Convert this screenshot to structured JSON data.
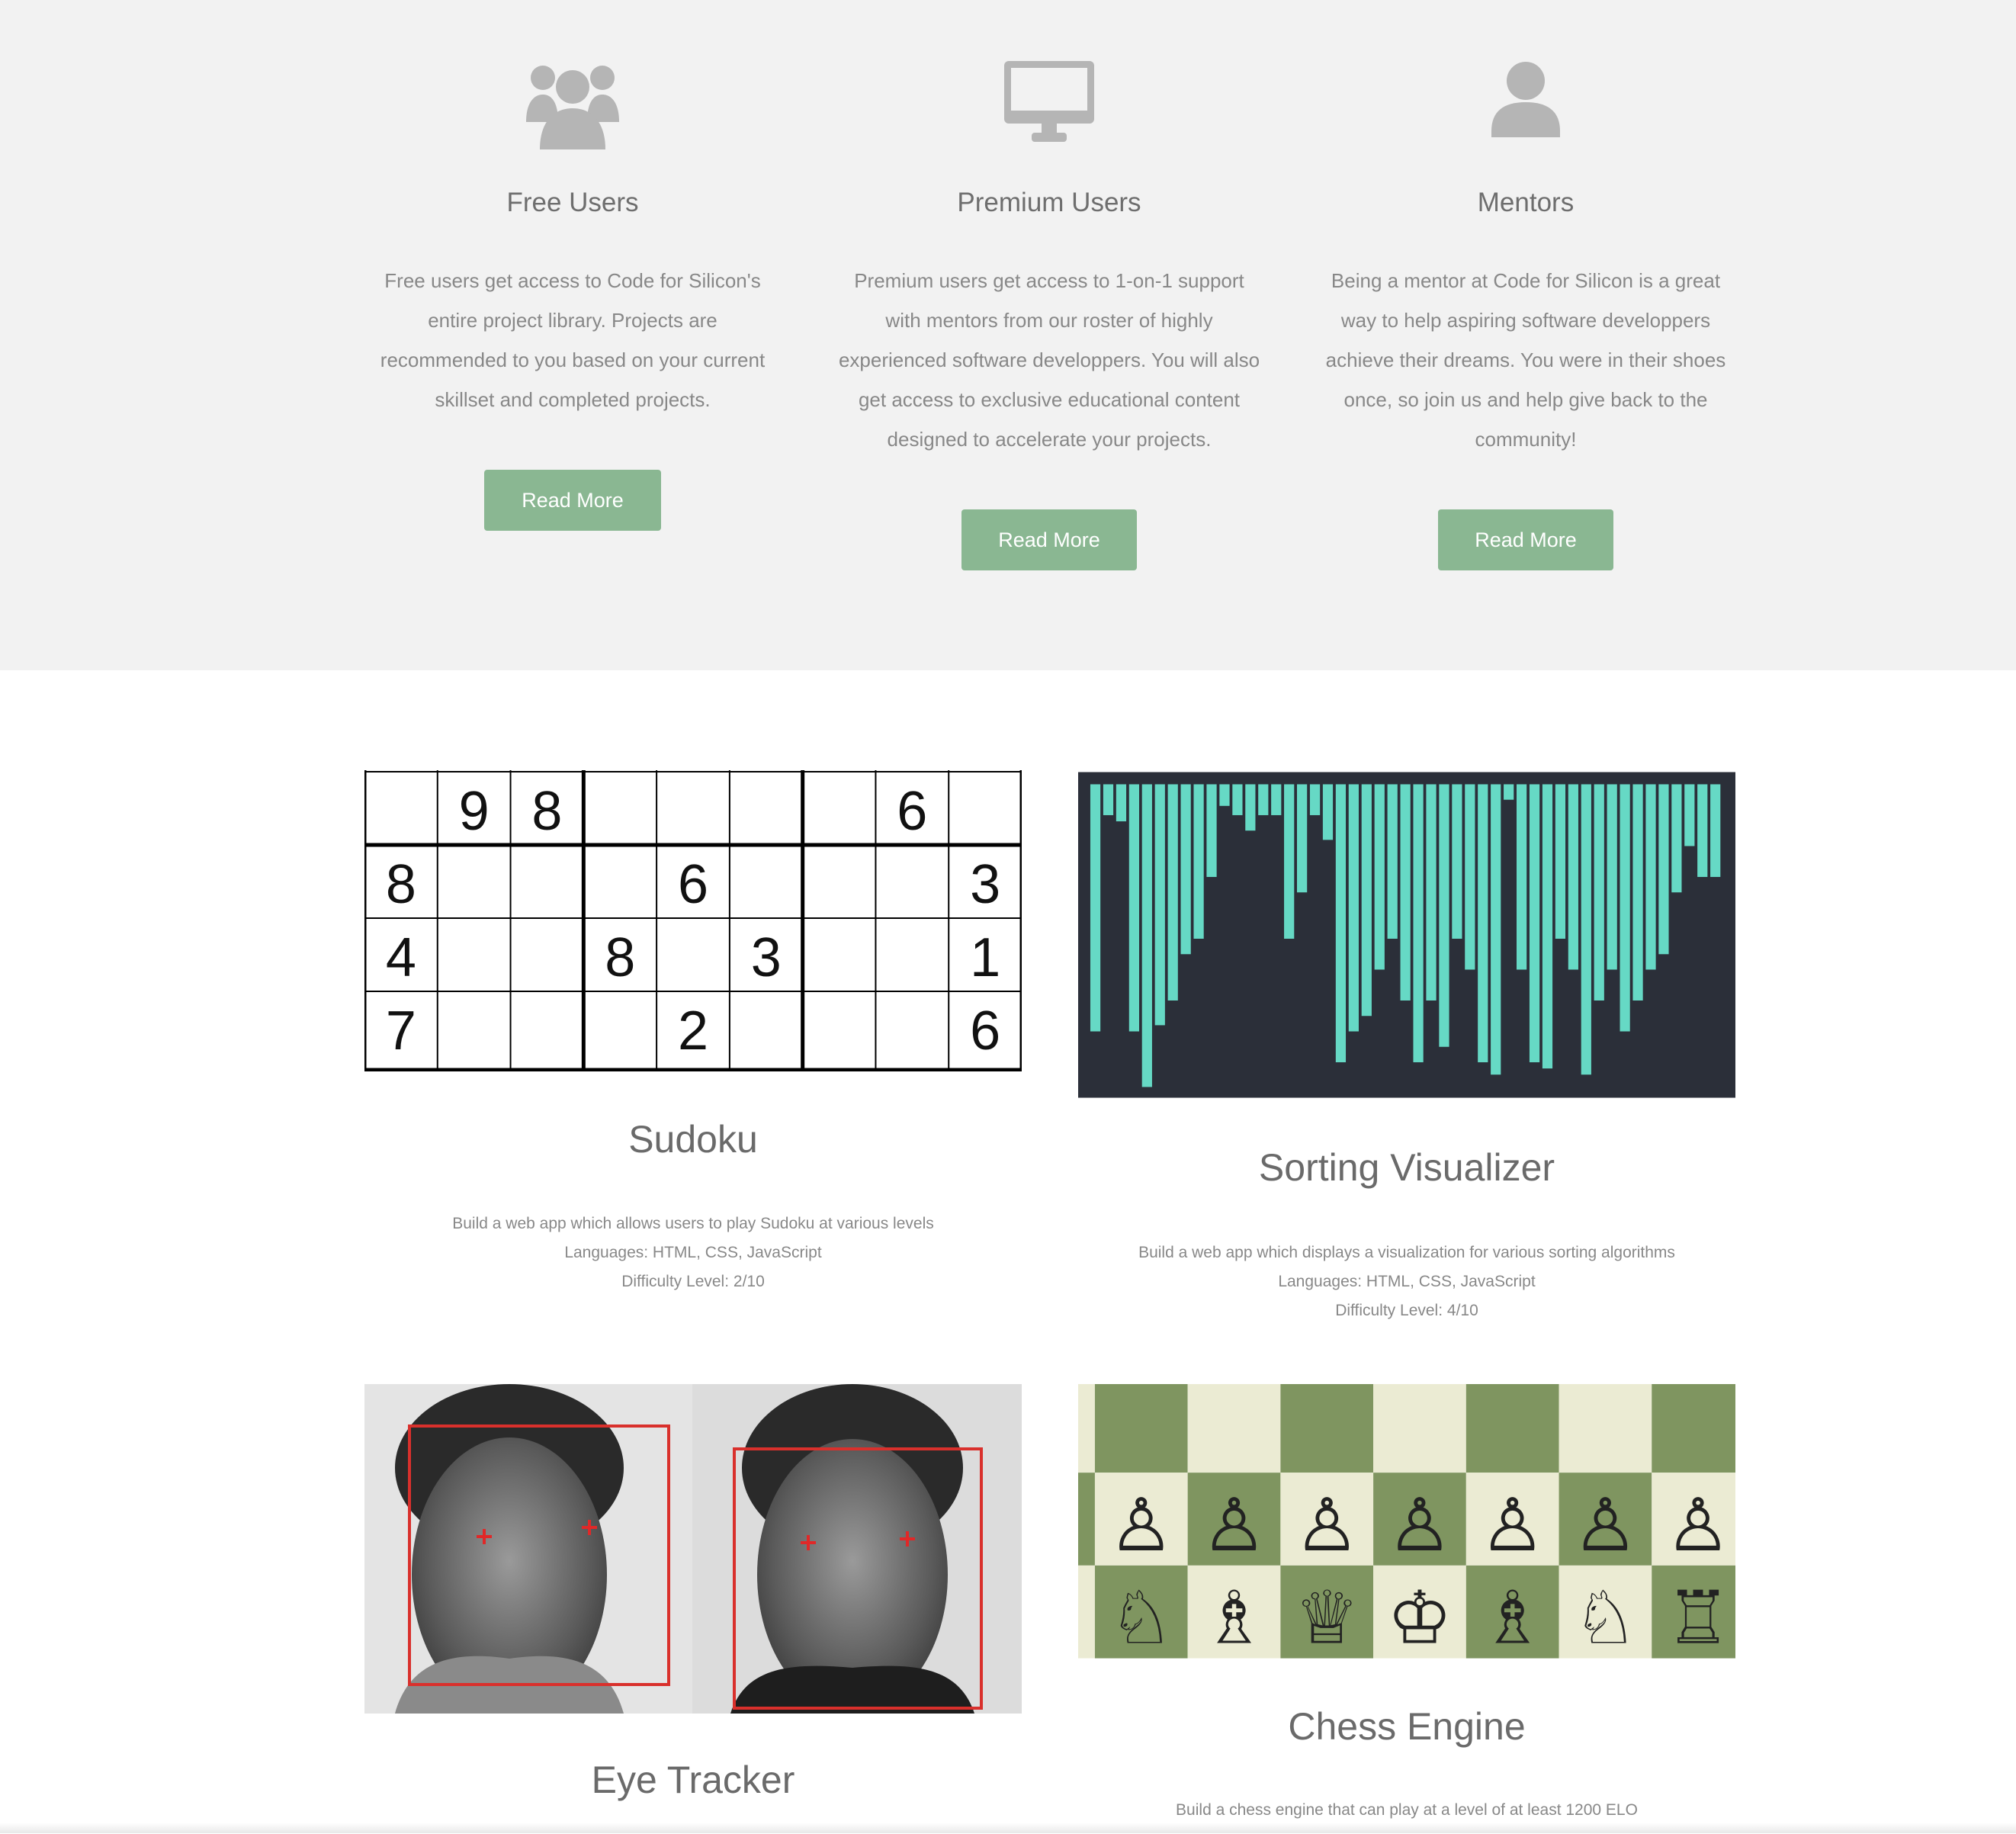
{
  "features": [
    {
      "title": "Free Users",
      "icon": "users-icon",
      "lines": [
        "Free users get access to Code for Silicon's",
        "entire project library. Projects are",
        "recommended to you based on your current",
        "skillset and completed projects."
      ],
      "button": "Read More"
    },
    {
      "title": "Premium Users",
      "icon": "desktop-icon",
      "lines": [
        "Premium users get access to 1-on-1 support",
        "with mentors from our roster of highly",
        "experienced software developpers. You will also",
        "get access to exclusive educational content",
        "designed to accelerate your projects."
      ],
      "button": "Read More"
    },
    {
      "title": "Mentors",
      "icon": "user-icon",
      "lines": [
        "Being a mentor at Code for Silicon is a great",
        "way to help aspiring software developpers",
        "achieve their dreams. You were in their shoes",
        "once, so join us and help give back to the",
        "community!"
      ],
      "button": "Read More"
    }
  ],
  "projects": [
    {
      "title": "Sudoku",
      "description": "Build a web app which allows users to play Sudoku at various levels",
      "languages": "Languages: HTML, CSS, JavaScript",
      "difficulty": "Difficulty Level: 2/10"
    },
    {
      "title": "Sorting Visualizer",
      "description": "Build a web app which displays a visualization for various sorting algorithms",
      "languages": "Languages: HTML, CSS, JavaScript",
      "difficulty": "Difficulty Level: 4/10"
    },
    {
      "title": "Eye Tracker"
    },
    {
      "title": "Chess Engine",
      "description": "Build a chess engine that can play at a level of at least 1200 ELO"
    }
  ],
  "sudoku_grid": [
    [
      "",
      "9",
      "8",
      "",
      "",
      "",
      "",
      "6",
      ""
    ],
    [
      "8",
      "",
      "",
      "",
      "6",
      "",
      "",
      "",
      "3"
    ],
    [
      "4",
      "",
      "",
      "8",
      "",
      "3",
      "",
      "",
      "1"
    ],
    [
      "7",
      "",
      "",
      "",
      "2",
      "",
      "",
      "",
      "6"
    ]
  ],
  "sorting_bars": [
    0.8,
    0.1,
    0.12,
    0.8,
    0.98,
    0.78,
    0.7,
    0.55,
    0.5,
    0.3,
    0.07,
    0.1,
    0.15,
    0.1,
    0.1,
    0.5,
    0.35,
    0.1,
    0.18,
    0.9,
    0.8,
    0.75,
    0.6,
    0.5,
    0.7,
    0.9,
    0.7,
    0.85,
    0.5,
    0.6,
    0.9,
    0.94,
    0.05,
    0.6,
    0.9,
    0.92,
    0.5,
    0.6,
    0.94,
    0.7,
    0.6,
    0.8,
    0.7,
    0.6,
    0.55,
    0.35,
    0.2,
    0.3,
    0.3
  ],
  "chess": {
    "pawn": "♙",
    "knight": "♘",
    "bishop": "♗",
    "queen": "♕",
    "king": "♔",
    "rook": "♖",
    "back_rank": [
      "♘",
      "♗",
      "♕",
      "♔",
      "♗",
      "♘",
      "♖"
    ]
  },
  "colors": {
    "button": "#8ab792",
    "features_bg": "#f2f2f2",
    "sort_bg": "#2b2f39",
    "sort_bar": "#66d9c5",
    "chess_light": "#ebebd3",
    "chess_dark": "#7f9560",
    "face_box": "#d9302c"
  }
}
